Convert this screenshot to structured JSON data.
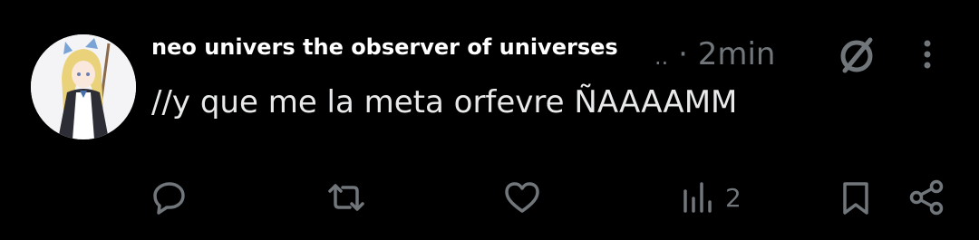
{
  "post": {
    "author_name": "neo univers the observer of universes",
    "ellipsis": "..",
    "separator": "·",
    "timestamp": "2min",
    "text": "//y que me la meta orfevre ÑAAAAMM"
  },
  "actions": {
    "reply_icon": "reply-icon",
    "repost_icon": "repost-icon",
    "like_icon": "heart-icon",
    "views_icon": "views-icon",
    "views_count": "2",
    "bookmark_icon": "bookmark-icon",
    "share_icon": "share-icon"
  },
  "header_icons": {
    "grok": "grok-icon",
    "more": "more-vertical-icon"
  },
  "colors": {
    "background": "#000000",
    "primary_text": "#e7e9ea",
    "secondary_text": "#71767b"
  }
}
